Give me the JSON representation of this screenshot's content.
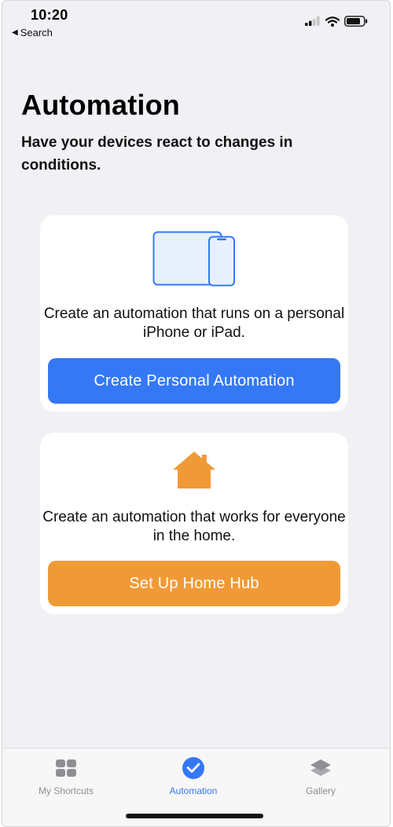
{
  "status_bar": {
    "time": "10:20",
    "back_label": "Search",
    "icons": [
      "signal-icon",
      "wifi-icon",
      "battery-icon"
    ]
  },
  "header": {
    "title": "Automation",
    "subtitle": "Have your devices react to changes in conditions."
  },
  "cards": {
    "personal": {
      "icon": "ipad-iphone-icon",
      "description": "Create an automation that runs on a personal iPhone or iPad.",
      "button_label": "Create Personal Automation"
    },
    "home": {
      "icon": "home-icon",
      "description": "Create an automation that works for everyone in the home.",
      "button_label": "Set Up Home Hub"
    }
  },
  "tab_bar": {
    "tabs": [
      {
        "label": "My Shortcuts",
        "icon": "grid-icon",
        "selected": false
      },
      {
        "label": "Automation",
        "icon": "checkmark-circle-icon",
        "selected": true
      },
      {
        "label": "Gallery",
        "icon": "layers-icon",
        "selected": false
      }
    ]
  },
  "colors": {
    "accent_blue": "#3478f6",
    "accent_orange": "#f09a37",
    "background": "#f1f1f5",
    "tab_inactive": "#8e8e93"
  }
}
